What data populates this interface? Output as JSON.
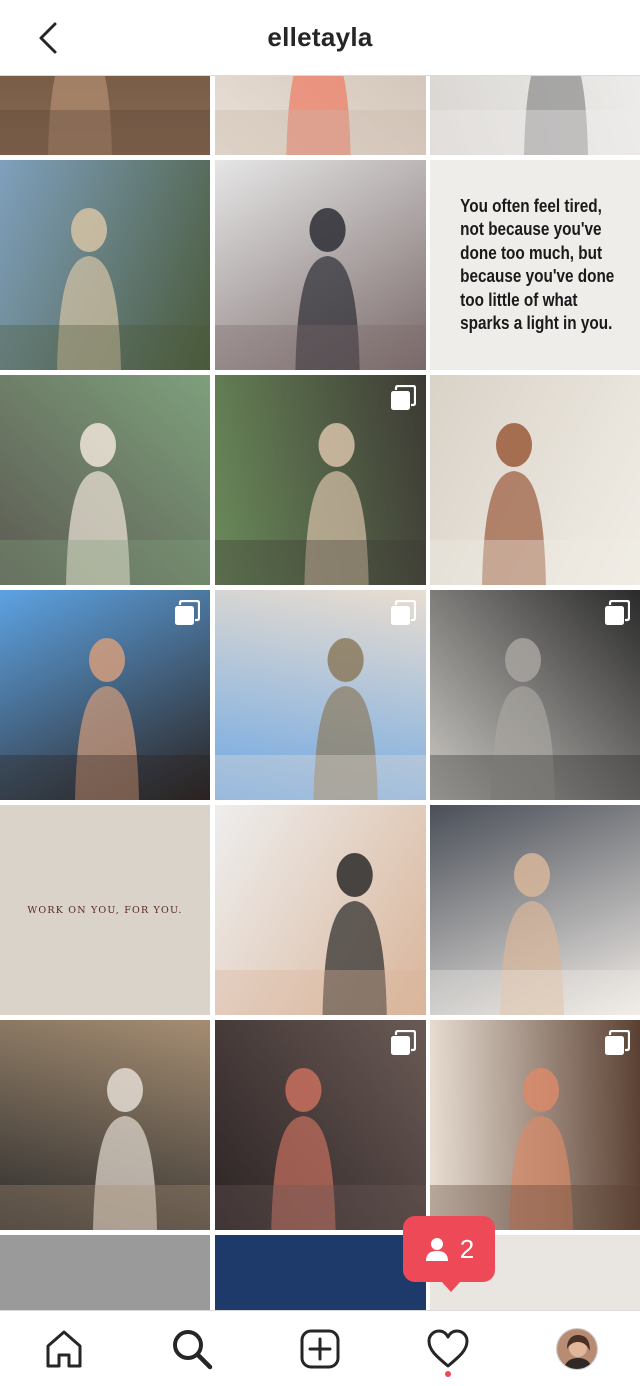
{
  "header": {
    "username": "elletayla"
  },
  "posts": [
    {
      "multi": false,
      "palette": [
        "#8a6a52",
        "#b38f72",
        "#5a4636"
      ]
    },
    {
      "multi": false,
      "palette": [
        "#e9e1d8",
        "#f07a62",
        "#c8b7a9"
      ]
    },
    {
      "multi": false,
      "palette": [
        "#d9d6d2",
        "#8c8c8c",
        "#f0efed"
      ]
    },
    {
      "multi": false,
      "palette": [
        "#7fa0bd",
        "#d6c3a5",
        "#4a5a3a"
      ]
    },
    {
      "multi": false,
      "palette": [
        "#e6e6e6",
        "#2e2e36",
        "#7a6a6a"
      ]
    },
    {
      "multi": false,
      "palette": [
        "#efedea",
        "#e4e1dd",
        "#d8d4cf"
      ],
      "quote": "You often feel tired,\nnot because you've\ndone too much, but\nbecause you've done\ntoo little of what\nsparks a light in you."
    },
    {
      "multi": false,
      "palette": [
        "#5c5a52",
        "#efe4d9",
        "#7ea07c"
      ]
    },
    {
      "multi": true,
      "palette": [
        "#6a8a5a",
        "#d8c2a9",
        "#3d3a34"
      ]
    },
    {
      "multi": false,
      "palette": [
        "#d9d2c7",
        "#9a5a3a",
        "#f1ede6"
      ]
    },
    {
      "multi": true,
      "palette": [
        "#5da3e3",
        "#d39d7c",
        "#2a2320"
      ]
    },
    {
      "multi": true,
      "palette": [
        "#6fa8e4",
        "#8c7a5e",
        "#e8ddd0"
      ]
    },
    {
      "multi": true,
      "palette": [
        "#ccc9c4",
        "#a8a5a0",
        "#2a2a2a"
      ]
    },
    {
      "multi": false,
      "palette": [
        "#d9d3ca",
        "#cec7bd",
        "#e1dbd2"
      ],
      "quote_small": "WORK ON YOU, FOR YOU."
    },
    {
      "multi": false,
      "palette": [
        "#eeeeee",
        "#2a2a2a",
        "#d9b59a"
      ]
    },
    {
      "multi": false,
      "palette": [
        "#4a4f58",
        "#d8b69a",
        "#f2ede8"
      ]
    },
    {
      "multi": false,
      "palette": [
        "#2c2c2c",
        "#e4dcd2",
        "#a58d72"
      ]
    },
    {
      "multi": true,
      "palette": [
        "#2b2324",
        "#c86f5f",
        "#6a5a55"
      ]
    },
    {
      "multi": true,
      "palette": [
        "#e9ded3",
        "#d98a6a",
        "#5a4032"
      ]
    }
  ],
  "notification": {
    "count": "2"
  },
  "tabs": [
    "home-icon",
    "search-icon",
    "add-post-icon",
    "activity-icon",
    "profile-avatar"
  ]
}
